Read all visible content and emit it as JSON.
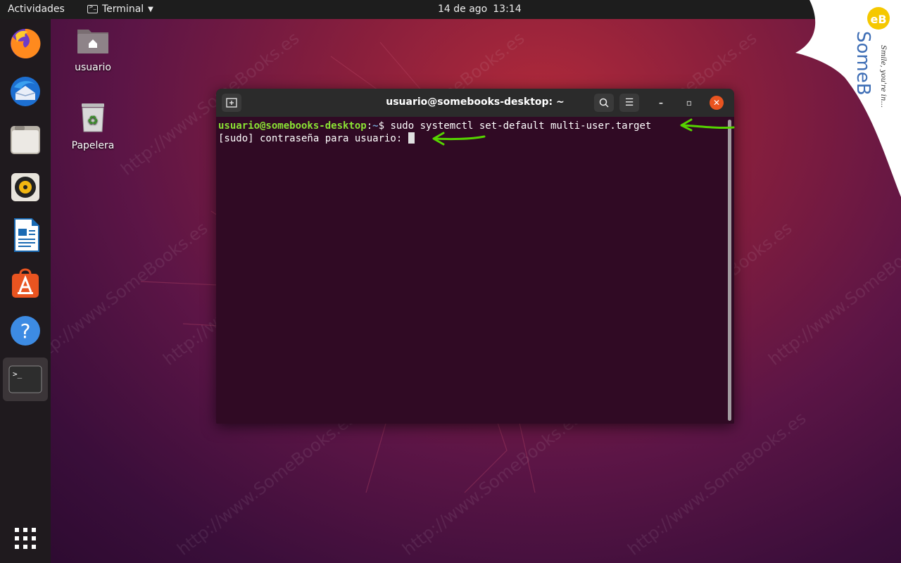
{
  "topbar": {
    "activities": "Actividades",
    "app_menu": "Terminal",
    "date": "14 de ago",
    "time": "13:14"
  },
  "dock": {
    "items": [
      {
        "name": "firefox-icon"
      },
      {
        "name": "thunderbird-icon"
      },
      {
        "name": "files-icon"
      },
      {
        "name": "rhythmbox-icon"
      },
      {
        "name": "writer-icon"
      },
      {
        "name": "software-icon"
      },
      {
        "name": "help-icon"
      },
      {
        "name": "terminal-icon"
      }
    ],
    "apps_grid": "show-applications-icon"
  },
  "desktop": {
    "home_label": "usuario",
    "trash_label": "Papelera"
  },
  "terminal": {
    "title": "usuario@somebooks-desktop: ~",
    "line1_user": "usuario@somebooks-desktop",
    "line1_sep": ":",
    "line1_path": "~",
    "line1_cmd": "$ sudo systemctl set-default multi-user.target",
    "line2": "[sudo] contraseña para usuario: "
  },
  "watermark": {
    "text": "http://www.SomeBooks.es",
    "logo_text": "SomeB",
    "logo_tagline": "Smile, you're in..."
  },
  "colors": {
    "accent": "#e95420",
    "terminal_bg": "#300a24",
    "prompt_user": "#8ae234",
    "prompt_path": "#729fcf",
    "annotation_arrow": "#56d400"
  }
}
